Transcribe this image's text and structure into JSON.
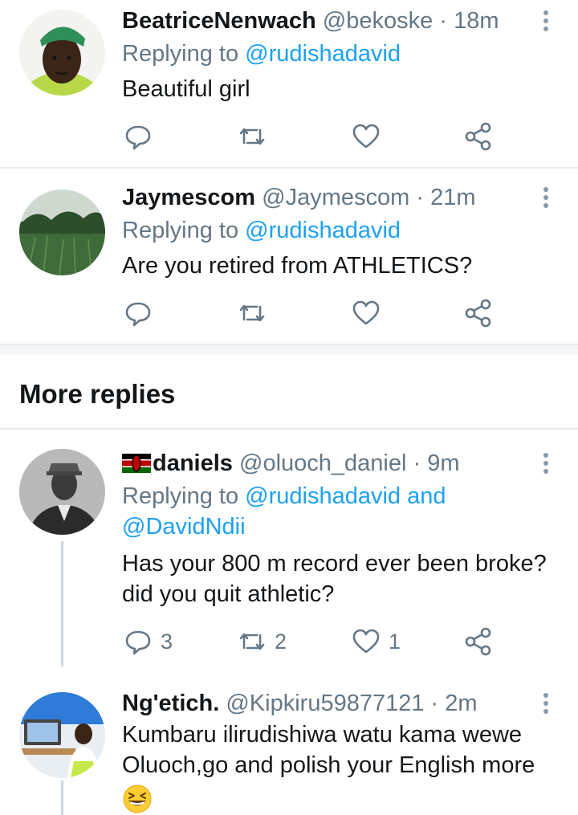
{
  "tweets": [
    {
      "display_name": "BeatriceNenwach",
      "handle": "@bekoske",
      "separator": "·",
      "time": "18m",
      "replying_prefix": "Replying to",
      "replying_to": "@rudishadavid",
      "text": "Beautiful girl"
    },
    {
      "display_name": "Jaymescom",
      "handle": "@Jaymescom",
      "separator": "·",
      "time": "21m",
      "replying_prefix": "Replying to",
      "replying_to": "@rudishadavid",
      "text": "Are you retired from ATHLETICS?"
    }
  ],
  "more_replies_title": "More replies",
  "more_replies": [
    {
      "display_name": "daniels",
      "flag_icon": "kenya-flag-icon",
      "handle": "@oluoch_daniel",
      "separator": "·",
      "time": "9m",
      "replying_prefix": "Replying to",
      "replying_to": "@rudishadavid",
      "replying_and": "and",
      "replying_to_second": "@DavidNdii",
      "text_line1": "Has your 800 m record ever been broke?",
      "text_line2": "did you quit athletic?",
      "reply_count": "3",
      "retweet_count": "2",
      "like_count": "1"
    },
    {
      "display_name": "Ng'etich.",
      "handle": "@Kipkiru59877121",
      "separator": "·",
      "time": "2m",
      "text_line1": "Kumbaru ilirudishiwa watu kama wewe",
      "text_line2": "Oluoch,go and polish your English more",
      "emoji_icon": "grinning-squinting-face-icon"
    }
  ],
  "colors": {
    "accent": "#1da1f2",
    "secondary_text": "#657786",
    "icon": "#657786",
    "divider": "#e6ecf0"
  }
}
